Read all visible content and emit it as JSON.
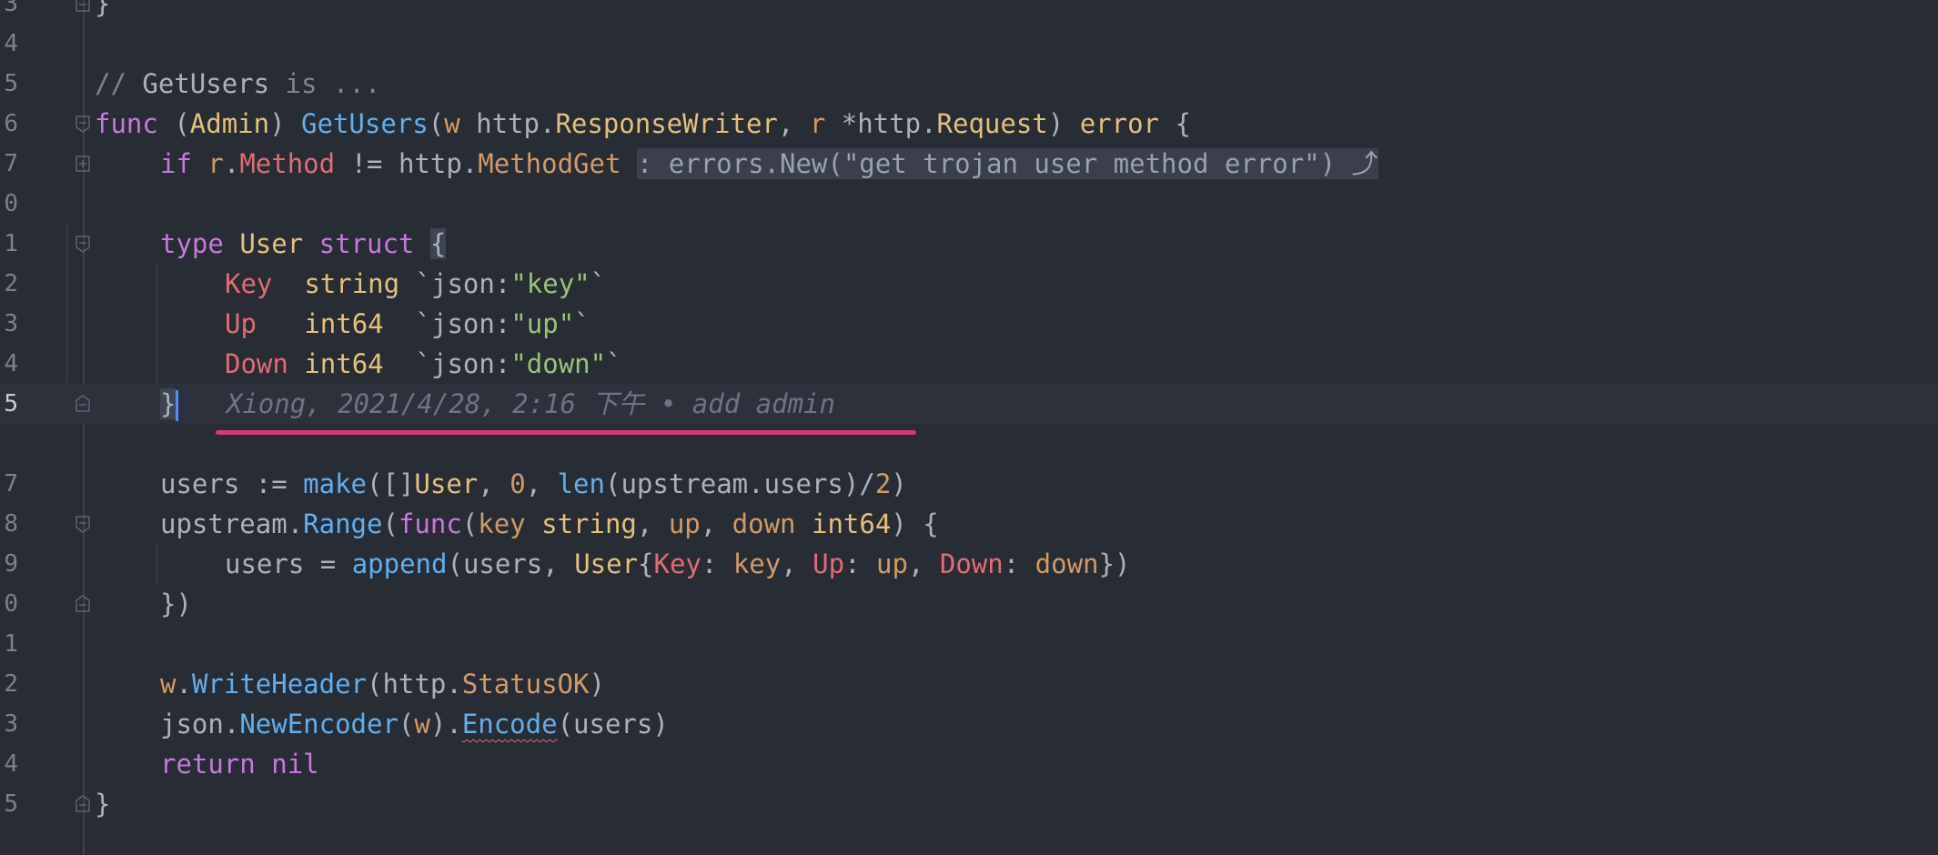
{
  "editor": {
    "line_numbers": [
      "3",
      "4",
      "5",
      "6",
      "7",
      "0",
      "1",
      "2",
      "3",
      "4",
      "5",
      "",
      "7",
      "8",
      "9",
      "0",
      "1",
      "2",
      "3",
      "4",
      "5"
    ],
    "lines": {
      "l3": {
        "brace": "}"
      },
      "l5": {
        "comment_slash": "//",
        "comment_name": "GetUsers",
        "comment_rest": "is ..."
      },
      "l6": {
        "kw_func": "func",
        "lparen": "(",
        "recv_type": "Admin",
        "rparen": ")",
        "fn_name": "GetUsers",
        "p_open": "(",
        "w": "w",
        "pkg1": "http",
        "dot1": ".",
        "type1": "ResponseWriter",
        "comma": ",",
        "r": "r",
        "star": "*",
        "pkg2": "http",
        "dot2": ".",
        "type2": "Request",
        "p_close": ")",
        "err_kw": "error",
        "brace": "{"
      },
      "l7": {
        "kw_if": "if",
        "r": "r",
        "dot": ".",
        "method": "Method",
        "op": "!=",
        "pkg": "http",
        "dot2": ".",
        "const": "MethodGet",
        "fold_hint": ": errors.New(\"get trojan user method error\") ⤴"
      },
      "l11": {
        "kw_type": "type",
        "name": "User",
        "kw_struct": "struct",
        "brace": "{"
      },
      "l12": {
        "field": "Key",
        "type": "string",
        "tag_open": "`json:",
        "tag_val": "\"key\"",
        "tag_close": "`"
      },
      "l13": {
        "field": "Up",
        "type": "int64",
        "tag_open": "`json:",
        "tag_val": "\"up\"",
        "tag_close": "`"
      },
      "l14": {
        "field": "Down",
        "type": "int64",
        "tag_open": "`json:",
        "tag_val": "\"down\"",
        "tag_close": "`"
      },
      "l15": {
        "brace": "}",
        "blame": "Xiong, 2021/4/28, 2:16 下午 • add admin"
      },
      "l17": {
        "users": "users",
        "assign": ":=",
        "make": "make",
        "lp": "(",
        "slice": "[]",
        "type": "User",
        "c1": ",",
        "zero": "0",
        "c2": ",",
        "len": "len",
        "lp2": "(",
        "arg": "upstream.users",
        "rp2": ")",
        "div": "/",
        "two": "2",
        "rp": ")"
      },
      "l18": {
        "pkg": "upstream",
        "dot": ".",
        "range": "Range",
        "lp": "(",
        "kw_func": "func",
        "lp2": "(",
        "key": "key",
        "string": "string",
        "c1": ",",
        "up": "up",
        "c2": ",",
        "down": "down",
        "int64": "int64",
        "rp2": ")",
        "brace": "{"
      },
      "l19": {
        "users": "users",
        "eq": "=",
        "append": "append",
        "lp": "(",
        "users2": "users",
        "c1": ",",
        "type": "User",
        "lb": "{",
        "key_f": "Key",
        "col1": ":",
        "key_v": "key",
        "c2": ",",
        "up_f": "Up",
        "col2": ":",
        "up_v": "up",
        "c3": ",",
        "down_f": "Down",
        "col3": ":",
        "down_v": "down",
        "rb": "})"
      },
      "l20": {
        "close": "})"
      },
      "l22": {
        "w": "w",
        "dot": ".",
        "fn": "WriteHeader",
        "lp": "(",
        "pkg": "http",
        "dot2": ".",
        "const": "StatusOK",
        "rp": ")"
      },
      "l23": {
        "pkg": "json",
        "dot": ".",
        "fn": "NewEncoder",
        "lp": "(",
        "w": "w",
        "rp": ")",
        "dot2": ".",
        "enc": "Encode",
        "lp2": "(",
        "arg": "users",
        "rp2": ")"
      },
      "l24": {
        "kw_return": "return",
        "nil": "nil"
      },
      "l25": {
        "brace": "}"
      }
    }
  }
}
